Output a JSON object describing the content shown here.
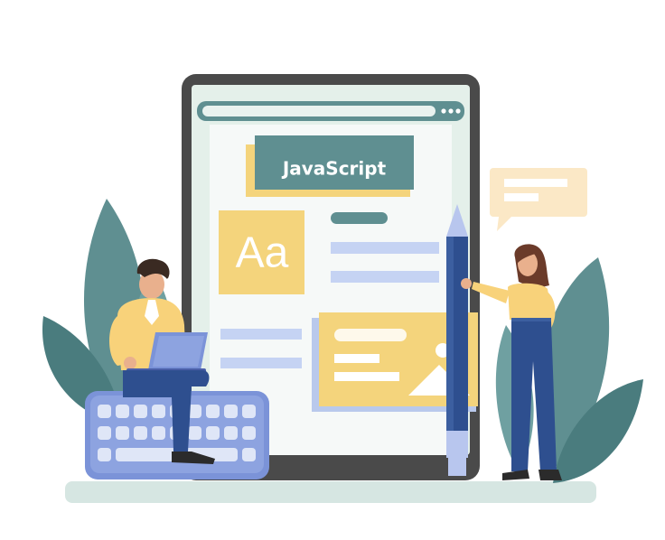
{
  "banner": {
    "text": "JavaScript"
  },
  "font_sample": {
    "text": "Aa"
  },
  "colors": {
    "teal": "#5f8f91",
    "teal_dark": "#4a7c7e",
    "mustard": "#f4d47c",
    "navy": "#2e4f8f",
    "periwinkle": "#b8c6ee",
    "tablet_frame": "#4a4a4a",
    "screen": "#e4f0ea",
    "floor": "#d6e6e2"
  },
  "icons": [
    "chat-bubble-icon",
    "image-placeholder-icon",
    "keyboard",
    "laptop",
    "pencil"
  ]
}
